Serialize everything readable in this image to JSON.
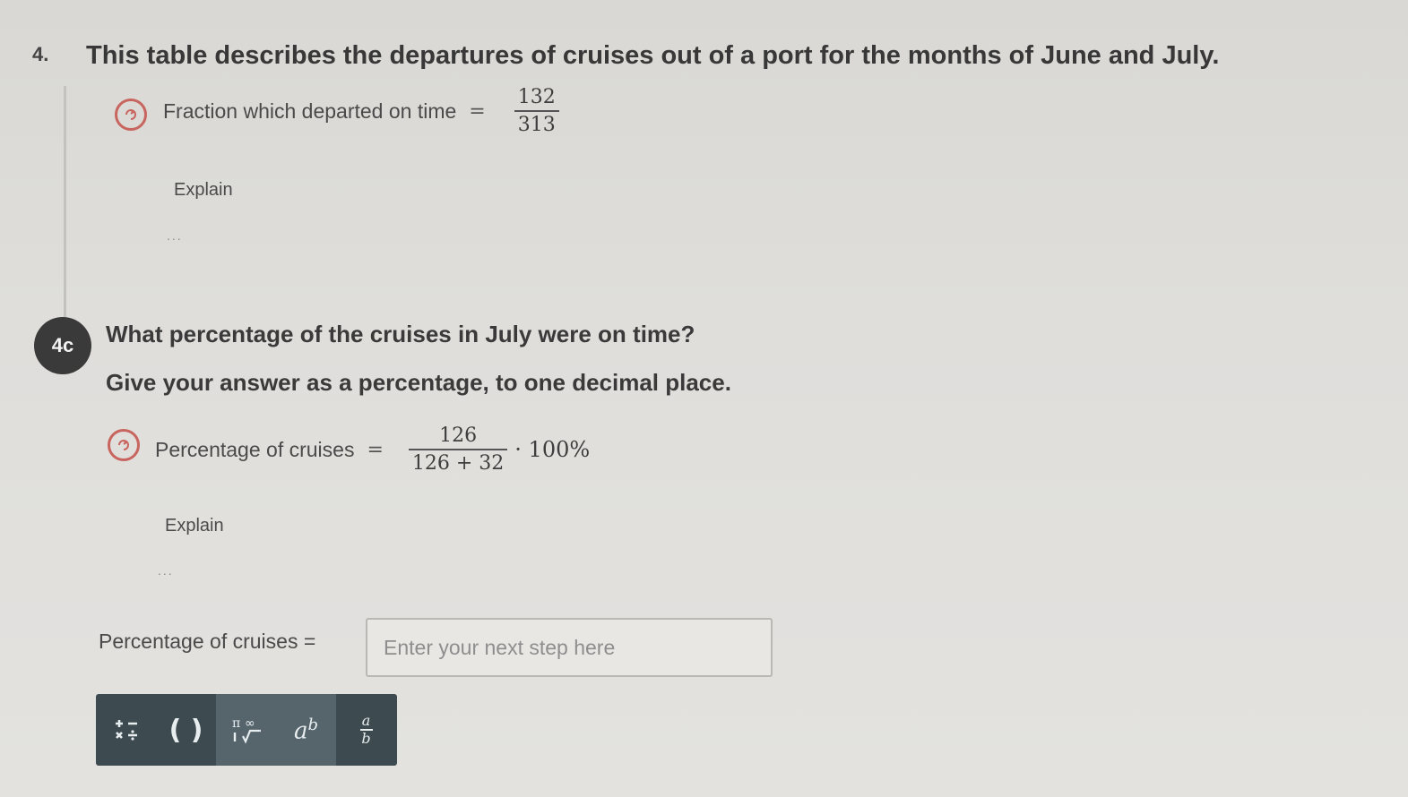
{
  "question": {
    "number": "4.",
    "title": "This table describes the departures of cruises out of a port for the months of June and July."
  },
  "step_prev": {
    "label": "Fraction which departed on time",
    "equals": "=",
    "numerator": "132",
    "denominator": "313",
    "explain": "Explain",
    "ellipsis": "..."
  },
  "part_4c": {
    "badge": "4c",
    "prompt_line1": "What percentage of the cruises in July were on time?",
    "prompt_line2": "Give your answer as a percentage, to one decimal place."
  },
  "step_current": {
    "label": "Percentage of cruises",
    "equals": "=",
    "numerator": "126",
    "denominator": "126 + 32",
    "multiplier": "· 100%",
    "explain": "Explain",
    "ellipsis": "..."
  },
  "answer": {
    "label": "Percentage of cruises =",
    "placeholder": "Enter your next step here",
    "value": ""
  },
  "toolbar": {
    "buttons": [
      {
        "icon": "basic-operators-icon"
      },
      {
        "icon": "parentheses-icon",
        "text": "( )"
      },
      {
        "icon": "pi-infinity-root-icon"
      },
      {
        "icon": "exponent-icon",
        "base": "a",
        "exp": "b"
      },
      {
        "icon": "fraction-icon",
        "num": "a",
        "den": "b"
      }
    ],
    "background": "#3d4a50"
  },
  "colors": {
    "step_icon": "#c9655f",
    "badge": "#3a3a3a"
  }
}
